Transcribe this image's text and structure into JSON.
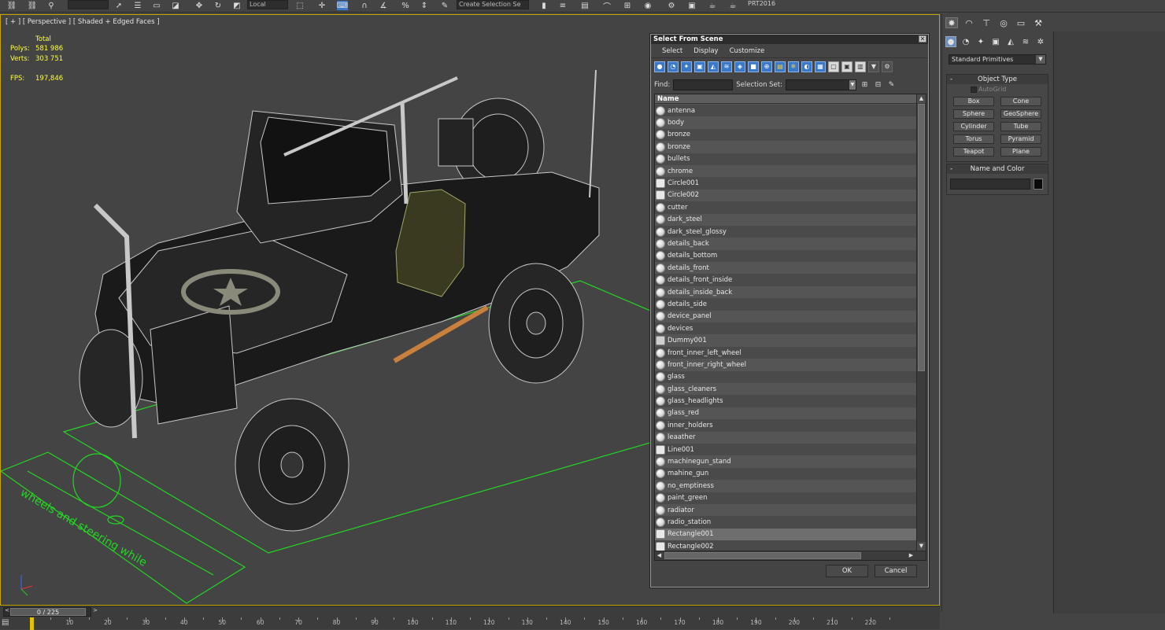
{
  "toolbar": {
    "reference_coord": "Local",
    "named_selection_placeholder": "Create Selection Se",
    "version": "PRT2016"
  },
  "viewport": {
    "label": "[ + ] [ Perspective ] [ Shaded + Edged Faces ]",
    "stats": {
      "header": "Total",
      "polys_label": "Polys:",
      "polys_value": "581 986",
      "verts_label": "Verts:",
      "verts_value": "303 751",
      "fps_label": "FPS:",
      "fps_value": "197,846"
    },
    "ground_text": "wheels and steering while"
  },
  "dialog": {
    "title": "Select From Scene",
    "menu": [
      "Select",
      "Display",
      "Customize"
    ],
    "find_label": "Find:",
    "selection_set_label": "Selection Set:",
    "column_header": "Name",
    "ok_label": "OK",
    "cancel_label": "Cancel",
    "items": [
      {
        "name": "antenna",
        "kind": "geometry"
      },
      {
        "name": "body",
        "kind": "geometry"
      },
      {
        "name": "bronze",
        "kind": "geometry"
      },
      {
        "name": "bronze",
        "kind": "geometry"
      },
      {
        "name": "bullets",
        "kind": "geometry"
      },
      {
        "name": "chrome",
        "kind": "geometry"
      },
      {
        "name": "Circle001",
        "kind": "shape"
      },
      {
        "name": "Circle002",
        "kind": "shape"
      },
      {
        "name": "cutter",
        "kind": "geometry"
      },
      {
        "name": "dark_steel",
        "kind": "geometry"
      },
      {
        "name": "dark_steel_glossy",
        "kind": "geometry"
      },
      {
        "name": "details_back",
        "kind": "geometry"
      },
      {
        "name": "details_bottom",
        "kind": "geometry"
      },
      {
        "name": "details_front",
        "kind": "geometry"
      },
      {
        "name": "details_front_inside",
        "kind": "geometry"
      },
      {
        "name": "details_inside_back",
        "kind": "geometry"
      },
      {
        "name": "details_side",
        "kind": "geometry"
      },
      {
        "name": "device_panel",
        "kind": "geometry"
      },
      {
        "name": "devices",
        "kind": "geometry"
      },
      {
        "name": "Dummy001",
        "kind": "helper"
      },
      {
        "name": "front_inner_left_wheel",
        "kind": "geometry"
      },
      {
        "name": "front_inner_right_wheel",
        "kind": "geometry"
      },
      {
        "name": "glass",
        "kind": "geometry"
      },
      {
        "name": "glass_cleaners",
        "kind": "geometry"
      },
      {
        "name": "glass_headlights",
        "kind": "geometry"
      },
      {
        "name": "glass_red",
        "kind": "geometry"
      },
      {
        "name": "inner_holders",
        "kind": "geometry"
      },
      {
        "name": "leaather",
        "kind": "geometry"
      },
      {
        "name": "Line001",
        "kind": "shape"
      },
      {
        "name": "machinegun_stand",
        "kind": "geometry"
      },
      {
        "name": "mahine_gun",
        "kind": "geometry"
      },
      {
        "name": "no_emptiness",
        "kind": "geometry"
      },
      {
        "name": "paint_green",
        "kind": "geometry"
      },
      {
        "name": "radiator",
        "kind": "geometry"
      },
      {
        "name": "radio_station",
        "kind": "geometry"
      },
      {
        "name": "Rectangle001",
        "kind": "shape",
        "selected": true
      },
      {
        "name": "Rectangle002",
        "kind": "shape"
      }
    ]
  },
  "command_panel": {
    "category": "Standard Primitives",
    "object_type_title": "Object Type",
    "autogrid_label": "AutoGrid",
    "buttons": [
      "Box",
      "Cone",
      "Sphere",
      "GeoSphere",
      "Cylinder",
      "Tube",
      "Torus",
      "Pyramid",
      "Teapot",
      "Plane"
    ],
    "name_color_title": "Name and Color"
  },
  "timeline": {
    "slider_label": "0 / 225",
    "ticks": [
      "10",
      "20",
      "30",
      "40",
      "50",
      "60",
      "70",
      "80",
      "90",
      "100",
      "110",
      "120",
      "130",
      "140",
      "150",
      "160",
      "170",
      "180",
      "190",
      "200",
      "210",
      "220"
    ]
  },
  "colors": {
    "viewport_border": "#c8a400",
    "stats_text": "#ffff3a",
    "grid_green": "#23d623",
    "wire": "#c8c8c8",
    "dialog_accent": "#3a78c8"
  }
}
